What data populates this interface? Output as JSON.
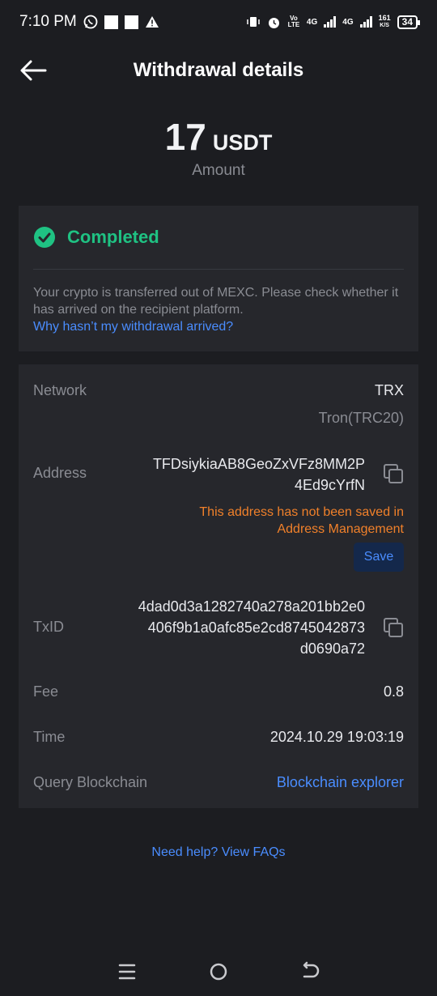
{
  "status_bar": {
    "time": "7:10 PM",
    "network_speed": "161",
    "network_speed_unit": "K/S",
    "battery": "34",
    "net1": "4G",
    "net2": "4G",
    "volte": "Vo LTE"
  },
  "header": {
    "title": "Withdrawal details",
    "back_icon": "arrow-left-icon"
  },
  "amount": {
    "value": "17",
    "unit": "USDT",
    "label": "Amount"
  },
  "status_card": {
    "status": "Completed",
    "status_color": "#1fc283",
    "description": "Your crypto is transferred out of MEXC. Please check whether it has arrived on the recipient platform.",
    "link": "Why hasn’t my withdrawal arrived?"
  },
  "details": {
    "network_label": "Network",
    "network_value": "TRX",
    "network_sub": "Tron(TRC20)",
    "address_label": "Address",
    "address_line1": "TFDsiykiaAB8GeoZxVFz8MM2P",
    "address_line2": "4Ed9cYrfN",
    "warning_line1": "This address has not been saved in",
    "warning_line2": "Address Management",
    "save_label": "Save",
    "txid_label": "TxID",
    "txid_line1": "4dad0d3a1282740a278a201bb2e0",
    "txid_line2": "406f9b1a0afc85e2cd8745042873",
    "txid_line3": "d0690a72",
    "fee_label": "Fee",
    "fee_value": "0.8",
    "time_label": "Time",
    "time_value": "2024.10.29 19:03:19",
    "query_label": "Query Blockchain",
    "query_link": "Blockchain explorer"
  },
  "help_link": "Need help? View FAQs",
  "colors": {
    "accent_blue": "#4a8dff",
    "warning_orange": "#f0802a",
    "background": "#1c1d21",
    "card": "#26272c"
  }
}
